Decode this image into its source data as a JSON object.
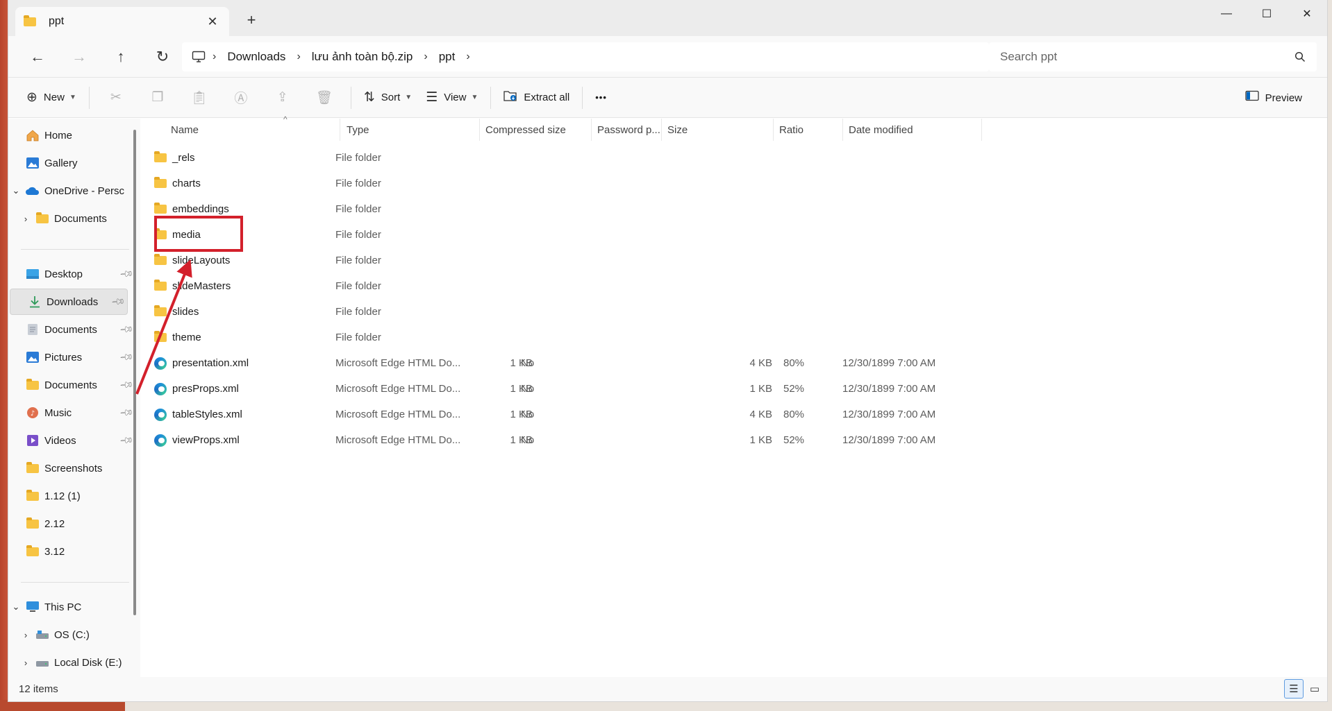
{
  "window": {
    "tab_title": "ppt",
    "tab_close": "✕",
    "new_tab": "+",
    "minimize": "—",
    "maximize": "☐",
    "close": "✕"
  },
  "nav": {
    "back": "←",
    "forward": "→",
    "up": "↑",
    "refresh": "↻",
    "breadcrumbs": [
      "Downloads",
      "lưu ảnh toàn bộ.zip",
      "ppt"
    ],
    "search_placeholder": "Search ppt"
  },
  "commands": {
    "new_label": "New",
    "sort_label": "Sort",
    "view_label": "View",
    "extract_label": "Extract all",
    "more_label": "•••",
    "preview_label": "Preview"
  },
  "sidebar": {
    "items": [
      {
        "label": "Home",
        "icon": "home-icon"
      },
      {
        "label": "Gallery",
        "icon": "gallery-icon"
      },
      {
        "label": "OneDrive - Persc",
        "icon": "cloud-icon"
      },
      {
        "label": "Documents",
        "icon": "folder-icon"
      },
      {
        "label": "Desktop",
        "icon": "desktop-icon"
      },
      {
        "label": "Downloads",
        "icon": "download-icon"
      },
      {
        "label": "Documents",
        "icon": "document-icon"
      },
      {
        "label": "Pictures",
        "icon": "pictures-icon"
      },
      {
        "label": "Documents",
        "icon": "folder-icon"
      },
      {
        "label": "Music",
        "icon": "music-icon"
      },
      {
        "label": "Videos",
        "icon": "videos-icon"
      },
      {
        "label": "Screenshots",
        "icon": "folder-icon"
      },
      {
        "label": "1.12 (1)",
        "icon": "folder-icon"
      },
      {
        "label": "2.12",
        "icon": "folder-icon"
      },
      {
        "label": "3.12",
        "icon": "folder-icon"
      },
      {
        "label": "This PC",
        "icon": "computer-icon"
      },
      {
        "label": "OS (C:)",
        "icon": "drive-icon"
      },
      {
        "label": "Local Disk (E:)",
        "icon": "drive-icon"
      }
    ]
  },
  "columns": [
    "Name",
    "Type",
    "Compressed size",
    "Password p...",
    "Size",
    "Ratio",
    "Date modified"
  ],
  "files": [
    {
      "name": "_rels",
      "type": "File folder",
      "compressed": "",
      "password": "",
      "size": "",
      "ratio": "",
      "date": "",
      "kind": "folder"
    },
    {
      "name": "charts",
      "type": "File folder",
      "compressed": "",
      "password": "",
      "size": "",
      "ratio": "",
      "date": "",
      "kind": "folder"
    },
    {
      "name": "embeddings",
      "type": "File folder",
      "compressed": "",
      "password": "",
      "size": "",
      "ratio": "",
      "date": "",
      "kind": "folder"
    },
    {
      "name": "media",
      "type": "File folder",
      "compressed": "",
      "password": "",
      "size": "",
      "ratio": "",
      "date": "",
      "kind": "folder"
    },
    {
      "name": "slideLayouts",
      "type": "File folder",
      "compressed": "",
      "password": "",
      "size": "",
      "ratio": "",
      "date": "",
      "kind": "folder"
    },
    {
      "name": "slideMasters",
      "type": "File folder",
      "compressed": "",
      "password": "",
      "size": "",
      "ratio": "",
      "date": "",
      "kind": "folder"
    },
    {
      "name": "slides",
      "type": "File folder",
      "compressed": "",
      "password": "",
      "size": "",
      "ratio": "",
      "date": "",
      "kind": "folder"
    },
    {
      "name": "theme",
      "type": "File folder",
      "compressed": "",
      "password": "",
      "size": "",
      "ratio": "",
      "date": "",
      "kind": "folder"
    },
    {
      "name": "presentation.xml",
      "type": "Microsoft Edge HTML Do...",
      "compressed": "1 KB",
      "password": "No",
      "size": "4 KB",
      "ratio": "80%",
      "date": "12/30/1899 7:00 AM",
      "kind": "edge"
    },
    {
      "name": "presProps.xml",
      "type": "Microsoft Edge HTML Do...",
      "compressed": "1 KB",
      "password": "No",
      "size": "1 KB",
      "ratio": "52%",
      "date": "12/30/1899 7:00 AM",
      "kind": "edge"
    },
    {
      "name": "tableStyles.xml",
      "type": "Microsoft Edge HTML Do...",
      "compressed": "1 KB",
      "password": "No",
      "size": "4 KB",
      "ratio": "80%",
      "date": "12/30/1899 7:00 AM",
      "kind": "edge"
    },
    {
      "name": "viewProps.xml",
      "type": "Microsoft Edge HTML Do...",
      "compressed": "1 KB",
      "password": "No",
      "size": "1 KB",
      "ratio": "52%",
      "date": "12/30/1899 7:00 AM",
      "kind": "edge"
    }
  ],
  "status": {
    "count": "12 items"
  },
  "colors": {
    "accent": "#0067c0",
    "highlight": "#d3202b",
    "folder": "#f7c443"
  }
}
